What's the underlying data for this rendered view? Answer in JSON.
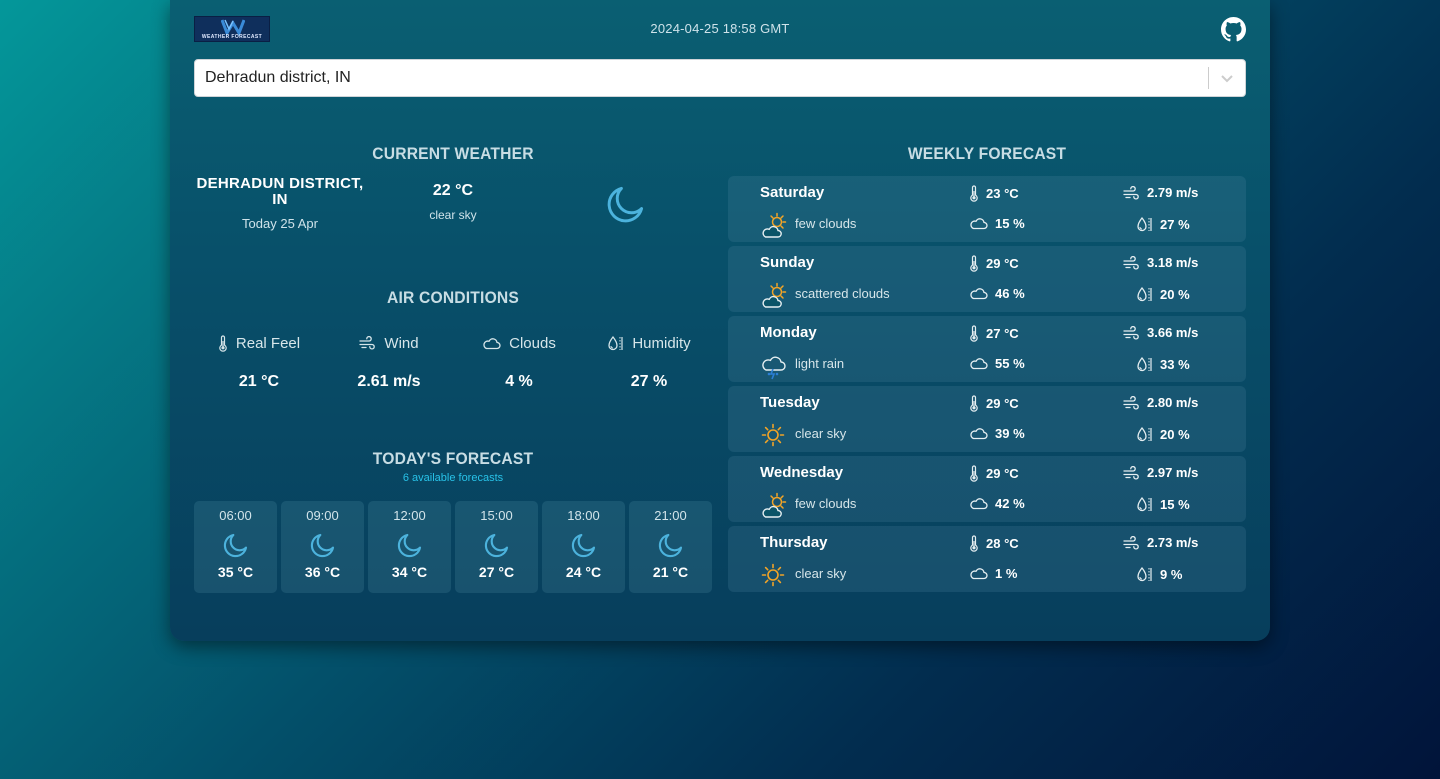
{
  "header": {
    "logo_text": "WEATHER FORECAST",
    "datetime": "2024-04-25 18:58 GMT"
  },
  "search": {
    "value": "Dehradun district, IN"
  },
  "current_weather": {
    "title": "CURRENT WEATHER",
    "city": "DEHRADUN DISTRICT, IN",
    "date": "Today 25 Apr",
    "temperature": "22 °C",
    "description": "clear sky",
    "icon": "moon-icon"
  },
  "air_conditions": {
    "title": "AIR CONDITIONS",
    "items": [
      {
        "label": "Real Feel",
        "value": "21 °C",
        "icon": "thermometer-icon"
      },
      {
        "label": "Wind",
        "value": "2.61 m/s",
        "icon": "wind-icon"
      },
      {
        "label": "Clouds",
        "value": "4 %",
        "icon": "cloud-icon"
      },
      {
        "label": "Humidity",
        "value": "27 %",
        "icon": "humidity-icon"
      }
    ]
  },
  "todays_forecast": {
    "title": "TODAY'S FORECAST",
    "subtitle": "6 available forecasts",
    "items": [
      {
        "time": "06:00",
        "temp": "35 °C",
        "icon": "moon-icon"
      },
      {
        "time": "09:00",
        "temp": "36 °C",
        "icon": "moon-icon"
      },
      {
        "time": "12:00",
        "temp": "34 °C",
        "icon": "moon-icon"
      },
      {
        "time": "15:00",
        "temp": "27 °C",
        "icon": "moon-icon"
      },
      {
        "time": "18:00",
        "temp": "24 °C",
        "icon": "moon-icon"
      },
      {
        "time": "21:00",
        "temp": "21 °C",
        "icon": "moon-icon"
      }
    ]
  },
  "weekly_forecast": {
    "title": "WEEKLY FORECAST",
    "days": [
      {
        "day": "Saturday",
        "description": "few clouds",
        "icon": "sun-cloud-icon",
        "temp": "23 °C",
        "wind": "2.79 m/s",
        "clouds": "15 %",
        "humidity": "27 %"
      },
      {
        "day": "Sunday",
        "description": "scattered clouds",
        "icon": "sun-cloud-icon",
        "temp": "29 °C",
        "wind": "3.18 m/s",
        "clouds": "46 %",
        "humidity": "20 %"
      },
      {
        "day": "Monday",
        "description": "light rain",
        "icon": "rain-cloud-icon",
        "temp": "27 °C",
        "wind": "3.66 m/s",
        "clouds": "55 %",
        "humidity": "33 %"
      },
      {
        "day": "Tuesday",
        "description": "clear sky",
        "icon": "sun-icon",
        "temp": "29 °C",
        "wind": "2.80 m/s",
        "clouds": "39 %",
        "humidity": "20 %"
      },
      {
        "day": "Wednesday",
        "description": "few clouds",
        "icon": "sun-cloud-icon",
        "temp": "29 °C",
        "wind": "2.97 m/s",
        "clouds": "42 %",
        "humidity": "15 %"
      },
      {
        "day": "Thursday",
        "description": "clear sky",
        "icon": "sun-icon",
        "temp": "28 °C",
        "wind": "2.73 m/s",
        "clouds": "1 %",
        "humidity": "9 %"
      }
    ]
  },
  "colors": {
    "accent": "#28c2e8",
    "moon": "#4cb3dd",
    "sun": "#f2a427"
  }
}
